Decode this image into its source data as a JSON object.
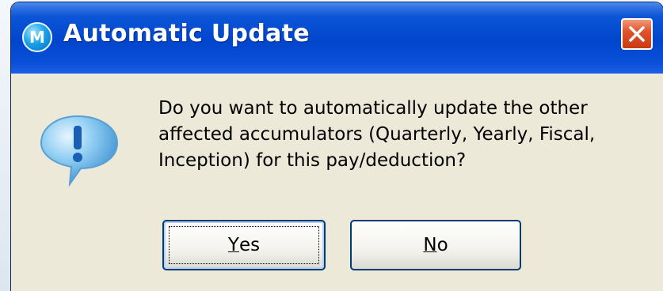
{
  "dialog": {
    "title": "Automatic Update",
    "app_icon_letter": "M",
    "icon": "information-icon",
    "message_lines": [
      "Do you want to automatically update the other",
      "affected accumulators (Quarterly, Yearly, Fiscal,",
      "Inception) for this pay/deduction?"
    ],
    "buttons": {
      "yes": {
        "mnemonic": "Y",
        "rest": "es"
      },
      "no": {
        "mnemonic": "N",
        "rest": "o"
      }
    }
  },
  "colors": {
    "titlebar": "#0046cc",
    "dialog_background": "#ece9d8",
    "close_button": "#e0542c",
    "button_border": "#003c74"
  }
}
